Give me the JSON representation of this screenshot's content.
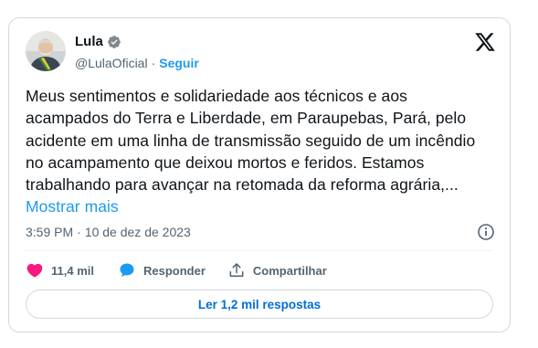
{
  "tweet": {
    "author": {
      "name": "Lula",
      "handle": "@LulaOficial",
      "separator": "·",
      "follow_label": "Seguir"
    },
    "text": "Meus sentimentos e solidariedade aos técnicos e aos acampados do Terra e Liberdade, em Paraupebas, Pará, pelo acidente em uma linha de transmissão seguido de um incêndio no acampamento que deixou mortos e feridos. Estamos trabalhando para avançar na retomada da reforma agrária,... ",
    "show_more_label": "Mostrar mais",
    "time": "3:59 PM",
    "date_separator": "·",
    "date": "10 de dez de 2023",
    "actions": {
      "likes": "11,4 mil",
      "reply_label": "Responder",
      "share_label": "Compartilhar"
    },
    "read_replies_label": "Ler 1,2 mil respostas"
  },
  "icons": {
    "logo": "x-logo-icon",
    "verified": "verified-badge-icon",
    "info": "info-icon",
    "like": "heart-icon",
    "reply": "reply-bubble-icon",
    "share": "share-icon"
  },
  "colors": {
    "accent": "#1d9bf0",
    "like": "#f91880",
    "text": "#0f1419",
    "muted": "#536471"
  }
}
